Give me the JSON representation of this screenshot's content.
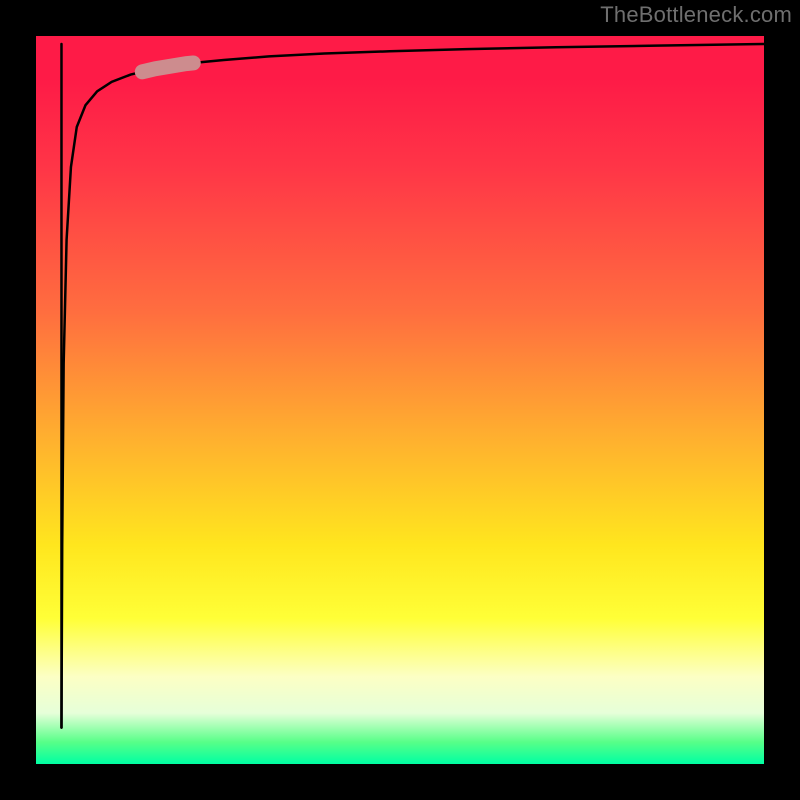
{
  "attribution_text": "TheBottleneck.com",
  "colors": {
    "frame_bg": "#000000",
    "curve_stroke": "#000000",
    "highlight_stroke": "#cd8c8e",
    "gradient_top": "#fe1b47",
    "gradient_bottom": "#00ffa3"
  },
  "chart_data": {
    "type": "line",
    "title": "",
    "xlabel": "",
    "ylabel": "",
    "xlim": [
      0,
      100
    ],
    "ylim": [
      0,
      100
    ],
    "series": [
      {
        "name": "bottleneck-curve",
        "x": [
          3.5,
          3.6,
          3.8,
          4.2,
          4.8,
          5.6,
          6.8,
          8.4,
          10.4,
          13.0,
          16.4,
          20.6,
          25.8,
          32.0,
          39.6,
          48.6,
          59.2,
          71.4,
          85.2,
          100.0
        ],
        "y": [
          5.0,
          30.0,
          55.0,
          72.0,
          82.0,
          87.5,
          90.5,
          92.4,
          93.7,
          94.7,
          95.5,
          96.2,
          96.7,
          97.2,
          97.6,
          97.9,
          98.2,
          98.45,
          98.68,
          98.9
        ]
      },
      {
        "name": "initial-spike",
        "x": [
          3.5,
          3.5,
          3.5
        ],
        "y": [
          98.9,
          52.0,
          5.0
        ]
      }
    ],
    "highlight_segment": {
      "along_series": "bottleneck-curve",
      "x_start": 14.6,
      "x_end": 21.6
    }
  }
}
